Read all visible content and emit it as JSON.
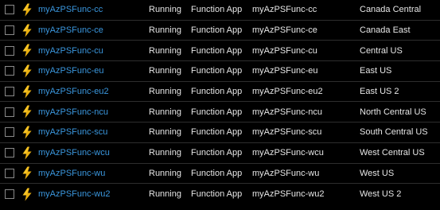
{
  "rows": [
    {
      "name": "myAzPSFunc-cc",
      "status": "Running",
      "type": "Function App",
      "app": "myAzPSFunc-cc",
      "location": "Canada Central"
    },
    {
      "name": "myAzPSFunc-ce",
      "status": "Running",
      "type": "Function App",
      "app": "myAzPSFunc-ce",
      "location": "Canada East"
    },
    {
      "name": "myAzPSFunc-cu",
      "status": "Running",
      "type": "Function App",
      "app": "myAzPSFunc-cu",
      "location": "Central US"
    },
    {
      "name": "myAzPSFunc-eu",
      "status": "Running",
      "type": "Function App",
      "app": "myAzPSFunc-eu",
      "location": "East US"
    },
    {
      "name": "myAzPSFunc-eu2",
      "status": "Running",
      "type": "Function App",
      "app": "myAzPSFunc-eu2",
      "location": "East US 2"
    },
    {
      "name": "myAzPSFunc-ncu",
      "status": "Running",
      "type": "Function App",
      "app": "myAzPSFunc-ncu",
      "location": "North Central US"
    },
    {
      "name": "myAzPSFunc-scu",
      "status": "Running",
      "type": "Function App",
      "app": "myAzPSFunc-scu",
      "location": "South Central US"
    },
    {
      "name": "myAzPSFunc-wcu",
      "status": "Running",
      "type": "Function App",
      "app": "myAzPSFunc-wcu",
      "location": "West Central US"
    },
    {
      "name": "myAzPSFunc-wu",
      "status": "Running",
      "type": "Function App",
      "app": "myAzPSFunc-wu",
      "location": "West US"
    },
    {
      "name": "myAzPSFunc-wu2",
      "status": "Running",
      "type": "Function App",
      "app": "myAzPSFunc-wu2",
      "location": "West US 2"
    }
  ],
  "icons": {
    "row_icon": "function-app-bolt-icon"
  },
  "colors": {
    "background": "#000000",
    "link": "#3a96dd",
    "text": "#e6e6e6",
    "bolt": "#f7c325",
    "bolt_dark": "#e0a100",
    "divider": "#2d2d2d"
  }
}
